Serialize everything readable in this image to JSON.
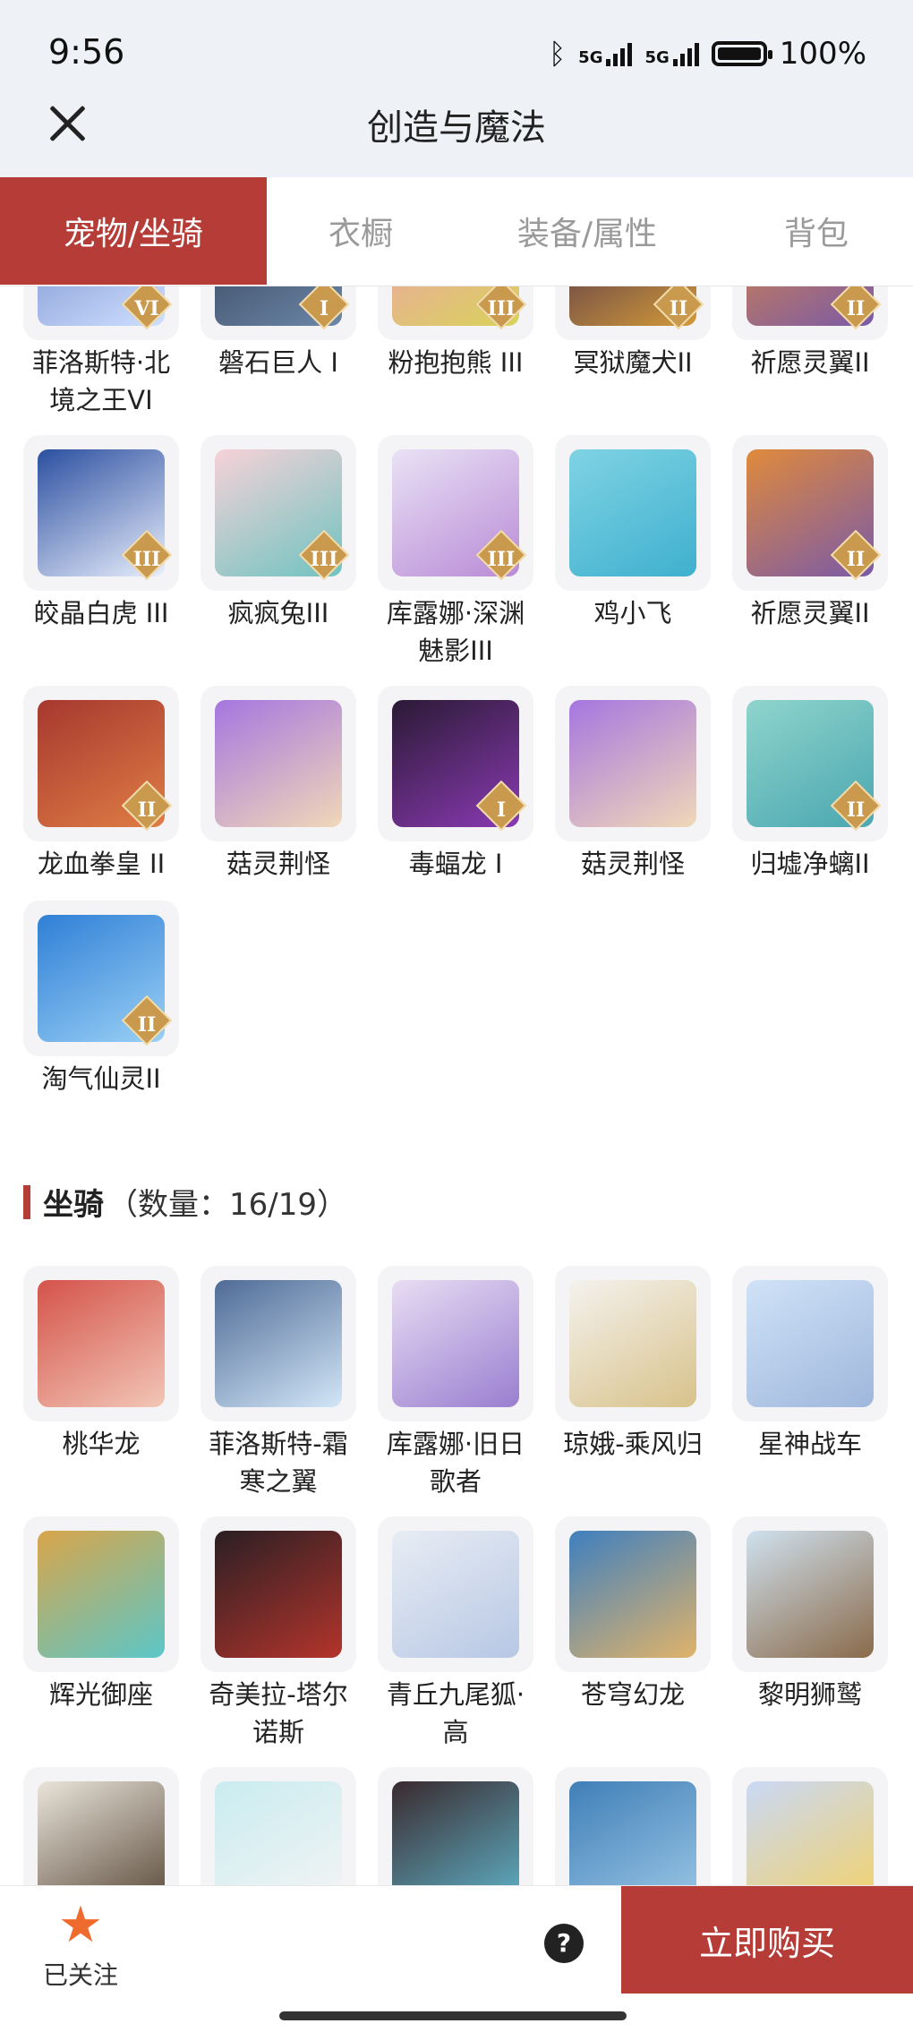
{
  "status": {
    "time": "9:56",
    "net1": "5G",
    "net2": "5G",
    "battery": "100%",
    "battery_level": 1.0
  },
  "header": {
    "title": "创造与魔法"
  },
  "tabs": [
    "宠物/坐骑",
    "衣橱",
    "装备/属性",
    "背包"
  ],
  "pets": [
    {
      "name": "菲洛斯特·北境之王VI",
      "badge": "VI",
      "colors": [
        "#6f86c8",
        "#cfe0ff"
      ]
    },
    {
      "name": "磐石巨人 I",
      "badge": "I",
      "colors": [
        "#2f3b52",
        "#6c87a8"
      ]
    },
    {
      "name": "粉抱抱熊 III",
      "badge": "III",
      "colors": [
        "#f29bb7",
        "#d8d35a"
      ]
    },
    {
      "name": "冥狱魔犬II",
      "badge": "II",
      "colors": [
        "#3a2350",
        "#d39a38"
      ]
    },
    {
      "name": "祈愿灵翼II",
      "badge": "II",
      "colors": [
        "#e08a3b",
        "#7a5aa8"
      ]
    },
    {
      "name": "皎晶白虎 III",
      "badge": "III",
      "colors": [
        "#2b4fa0",
        "#e8eefc"
      ]
    },
    {
      "name": "疯疯兔III",
      "badge": "III",
      "colors": [
        "#f6d2d8",
        "#6fc3c0"
      ]
    },
    {
      "name": "库露娜·深渊魅影III",
      "badge": "III",
      "colors": [
        "#e9e2f5",
        "#b98bd6"
      ]
    },
    {
      "name": "鸡小飞",
      "badge": "",
      "colors": [
        "#7fd3e3",
        "#3fb0cf"
      ]
    },
    {
      "name": "祈愿灵翼II",
      "badge": "II",
      "colors": [
        "#e08a3b",
        "#7a5aa8"
      ]
    },
    {
      "name": "龙血拳皇 II",
      "badge": "II",
      "colors": [
        "#a6382f",
        "#e07d45"
      ]
    },
    {
      "name": "菇灵荆怪",
      "badge": "",
      "colors": [
        "#a576e0",
        "#f0d8b8"
      ]
    },
    {
      "name": "毒蝠龙 I",
      "badge": "I",
      "colors": [
        "#2a1a34",
        "#8a3ab3"
      ]
    },
    {
      "name": "菇灵荆怪",
      "badge": "",
      "colors": [
        "#a576e0",
        "#f0d8b8"
      ]
    },
    {
      "name": "归墟净螭II",
      "badge": "II",
      "colors": [
        "#8fd4cc",
        "#4aa7b0"
      ]
    },
    {
      "name": "淘气仙灵II",
      "badge": "II",
      "colors": [
        "#2f7fd6",
        "#9ad0f5"
      ]
    }
  ],
  "mounts_section": {
    "title": "坐骑",
    "count": "（数量：16/19）"
  },
  "mounts": [
    {
      "name": "桃华龙",
      "colors": [
        "#d4534a",
        "#f2c6b6"
      ]
    },
    {
      "name": "菲洛斯特-霜寒之翼",
      "colors": [
        "#4f6b96",
        "#d2e6f7"
      ]
    },
    {
      "name": "库露娜·旧日歌者",
      "colors": [
        "#e8ddf3",
        "#9a7ed0"
      ]
    },
    {
      "name": "琼娥-乘风归",
      "colors": [
        "#f4f2ee",
        "#d8c28a"
      ]
    },
    {
      "name": "星神战车",
      "colors": [
        "#cfe2f7",
        "#9fb7dc"
      ]
    },
    {
      "name": "辉光御座",
      "colors": [
        "#d9a54a",
        "#5cc7c8"
      ]
    },
    {
      "name": "奇美拉-塔尔诺斯",
      "colors": [
        "#2b1f24",
        "#b3342b"
      ]
    },
    {
      "name": "青丘九尾狐·高",
      "colors": [
        "#e8edf4",
        "#b7c7e4"
      ]
    },
    {
      "name": "苍穹幻龙",
      "colors": [
        "#3e7fbf",
        "#e0b36a"
      ]
    },
    {
      "name": "黎明狮鹫",
      "colors": [
        "#cfe1ee",
        "#8a6a4a"
      ]
    },
    {
      "name": "",
      "colors": [
        "#e9e4da",
        "#5a4a3a"
      ]
    },
    {
      "name": "",
      "colors": [
        "#c9ecf0",
        "#f4f4f4"
      ]
    },
    {
      "name": "",
      "colors": [
        "#3a2a2e",
        "#5fb3c9"
      ]
    },
    {
      "name": "",
      "colors": [
        "#3f7fb7",
        "#9cc7e6"
      ]
    },
    {
      "name": "",
      "colors": [
        "#c9d8f5",
        "#f3d26a"
      ]
    }
  ],
  "bottom": {
    "follow_label": "已关注",
    "help": "?",
    "buy_label": "立即购买"
  }
}
